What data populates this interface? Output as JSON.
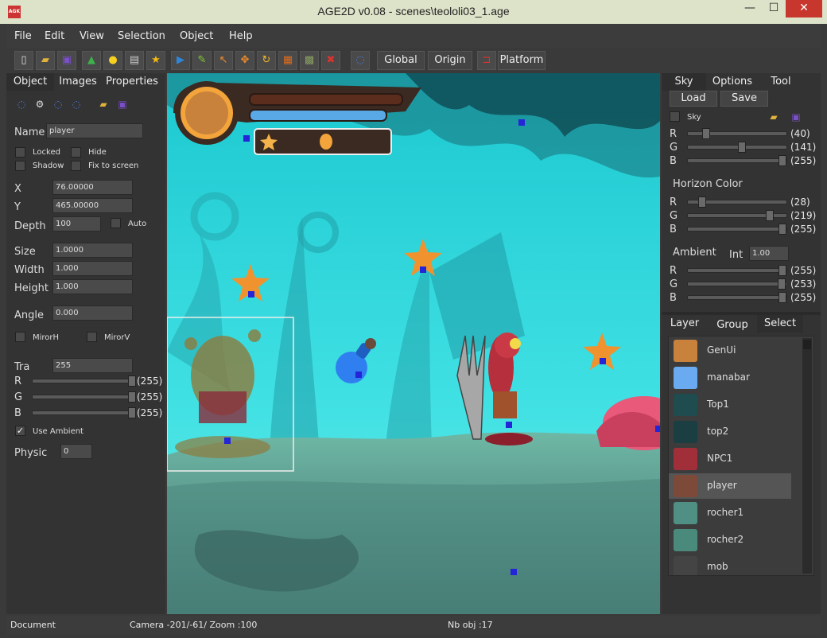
{
  "window": {
    "app_icon": "AGK",
    "title": "AGE2D v0.08 - scenes\\teololi03_1.age",
    "minimize": "—",
    "maximize": "☐",
    "close": "✕"
  },
  "menu": [
    "File",
    "Edit",
    "View",
    "Selection",
    "Object",
    "Help"
  ],
  "toolbar": {
    "icons": [
      "new-icon",
      "open-icon",
      "save-icon",
      "chart-icon",
      "light-icon",
      "image-icon",
      "star-icon",
      "play-icon",
      "pencil-icon",
      "arrow-icon",
      "move-icon",
      "rotate-icon",
      "scale-icon",
      "image-edit-icon",
      "delete-icon",
      "dots-icon"
    ],
    "global": "Global",
    "origin": "Origin",
    "platform": "Platform"
  },
  "left": {
    "tabs": [
      "Object",
      "Images",
      "Properties"
    ],
    "name_label": "Name",
    "name_value": "player",
    "locked": "Locked",
    "hide": "Hide",
    "shadow": "Shadow",
    "fix_to_screen": "Fix to screen",
    "x_label": "X",
    "x_value": "76.00000",
    "y_label": "Y",
    "y_value": "465.00000",
    "depth_label": "Depth",
    "depth_value": "100",
    "auto": "Auto",
    "size_label": "Size",
    "size_value": "1.0000",
    "width_label": "Width",
    "width_value": "1.000",
    "height_label": "Height",
    "height_value": "1.000",
    "angle_label": "Angle",
    "angle_value": "0.000",
    "mirorh": "MirorH",
    "mirorv": "MirorV",
    "tra_label": "Tra",
    "tra_value": "255",
    "r_label": "R",
    "r_value": "(255)",
    "g_label": "G",
    "g_value": "(255)",
    "b_label": "B",
    "b_value": "(255)",
    "use_ambient": "Use Ambient",
    "use_ambient_checked": true,
    "physic_label": "Physic",
    "physic_value": "0"
  },
  "right": {
    "tabs": [
      "Sky",
      "Options",
      "Tool"
    ],
    "load": "Load",
    "save": "Save",
    "sky_check": "Sky",
    "sky": {
      "r": "(40)",
      "g": "(141)",
      "b": "(255)",
      "r_frac": 0.157,
      "g_frac": 0.553,
      "b_frac": 1.0
    },
    "horizon_title": "Horizon Color",
    "horizon": {
      "r": "(28)",
      "g": "(219)",
      "b": "(255)",
      "r_frac": 0.11,
      "g_frac": 0.859,
      "b_frac": 1.0
    },
    "ambient_title": "Ambient",
    "int_label": "Int",
    "int_value": "1.00",
    "ambient": {
      "r": "(255)",
      "g": "(253)",
      "b": "(255)",
      "r_frac": 1.0,
      "g_frac": 0.992,
      "b_frac": 1.0
    },
    "r": "R",
    "g": "G",
    "b": "B",
    "layer_tabs": [
      "Layer",
      "Group",
      "Select"
    ],
    "layers": [
      "GenUi",
      "manabar",
      "Top1",
      "top2",
      "NPC1",
      "player",
      "rocher1",
      "rocher2",
      "mob"
    ]
  },
  "status": {
    "document": "Document",
    "camera": "Camera -201/-61/ Zoom :100",
    "nb_obj": "Nb obj :17"
  }
}
